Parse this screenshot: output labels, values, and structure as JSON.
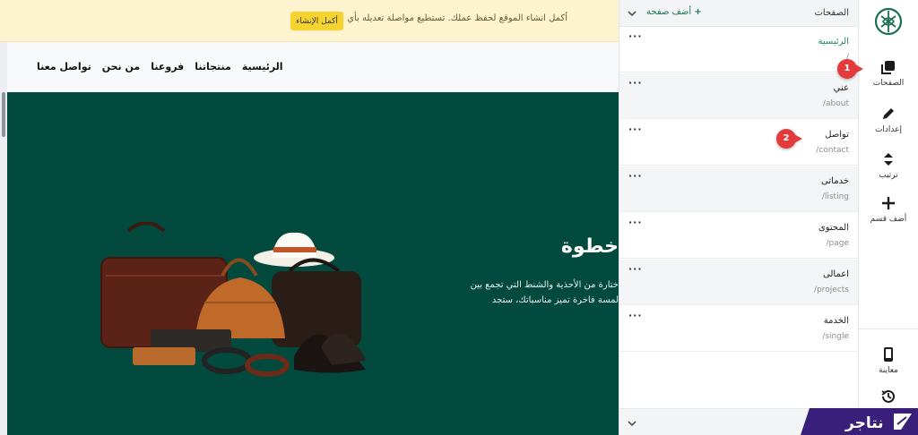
{
  "notice": {
    "text": "أكمل انشاء الموقع لحفظ عملك. تستطيع مواصلة تعديله بأي وقت",
    "button_label": "أكمل الإنشاء"
  },
  "site_nav": {
    "items": [
      "الرئيسية",
      "منتجاتنا",
      "فروعنا",
      "من نحن",
      "تواصل معنا"
    ]
  },
  "hero": {
    "title": "خطوة",
    "desc_line1": "ختارة من الأحذية والشنط التي تجمع بين",
    "desc_line2": "لمسة فاخرة تميز مناسباتك، ستجد"
  },
  "pages_panel": {
    "title": "الصفحات",
    "add_label": "أضف صفحة",
    "more_glyph": "···",
    "pages": [
      {
        "name": "الرئيسية",
        "slug": "/"
      },
      {
        "name": "عني",
        "slug": "/about"
      },
      {
        "name": "تواصل",
        "slug": "/contact"
      },
      {
        "name": "خدماتى",
        "slug": "/listing"
      },
      {
        "name": "المحتوى",
        "slug": "/page"
      },
      {
        "name": "اعمالى",
        "slug": "/projects"
      },
      {
        "name": "الخدمة",
        "slug": "/single"
      }
    ]
  },
  "sidebar": {
    "items": [
      {
        "label": "الصفحات",
        "icon": "pages-icon"
      },
      {
        "label": "إعدادات",
        "icon": "pencil-icon"
      },
      {
        "label": "ترتيب",
        "icon": "sort-icon"
      },
      {
        "label": "أضف قسم",
        "icon": "plus-icon"
      }
    ],
    "preview_label": "معاينة",
    "history_icon": "history-icon"
  },
  "callouts": {
    "one": "1",
    "two": "2"
  },
  "watermark": {
    "text": "نتاجر",
    "partial_text": "ظ"
  },
  "colors": {
    "accent_green": "#1d8a5c",
    "hero_bg": "#024a3d",
    "notice_bg": "#fdf3cf",
    "notice_button": "#f7d330",
    "badge_red": "#e33b3b",
    "watermark_purple": "#3a1f7a"
  }
}
